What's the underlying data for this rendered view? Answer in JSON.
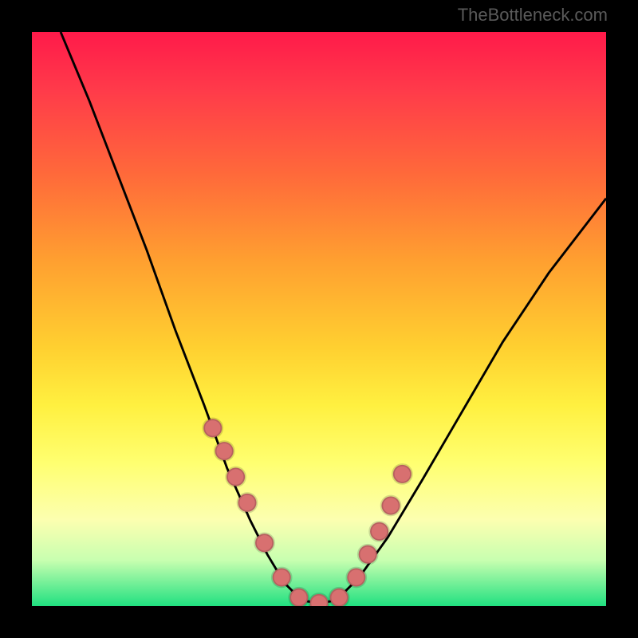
{
  "watermark": "TheBottleneck.com",
  "chart_data": {
    "type": "line",
    "title": "",
    "xlabel": "",
    "ylabel": "",
    "xlim": [
      0,
      100
    ],
    "ylim": [
      0,
      100
    ],
    "series": [
      {
        "name": "curve",
        "x": [
          5,
          10,
          15,
          20,
          25,
          30,
          34,
          38,
          41,
          44,
          47,
          50,
          53,
          57,
          62,
          68,
          75,
          82,
          90,
          100
        ],
        "values": [
          100,
          88,
          75,
          62,
          48,
          35,
          24,
          15,
          9,
          4,
          1,
          0.5,
          1,
          5,
          12,
          22,
          34,
          46,
          58,
          71
        ]
      },
      {
        "name": "dots",
        "x": [
          31.5,
          33.5,
          35.5,
          37.5,
          40.5,
          43.5,
          46.5,
          50,
          53.5,
          56.5,
          58.5,
          60.5,
          62.5,
          64.5
        ],
        "values": [
          31,
          27,
          22.5,
          18,
          11,
          5,
          1.5,
          0.5,
          1.5,
          5,
          9,
          13,
          17.5,
          23
        ]
      }
    ],
    "background": "red-yellow-green vertical gradient",
    "colors": {
      "curve": "#000000",
      "dots": "#d87070"
    }
  }
}
